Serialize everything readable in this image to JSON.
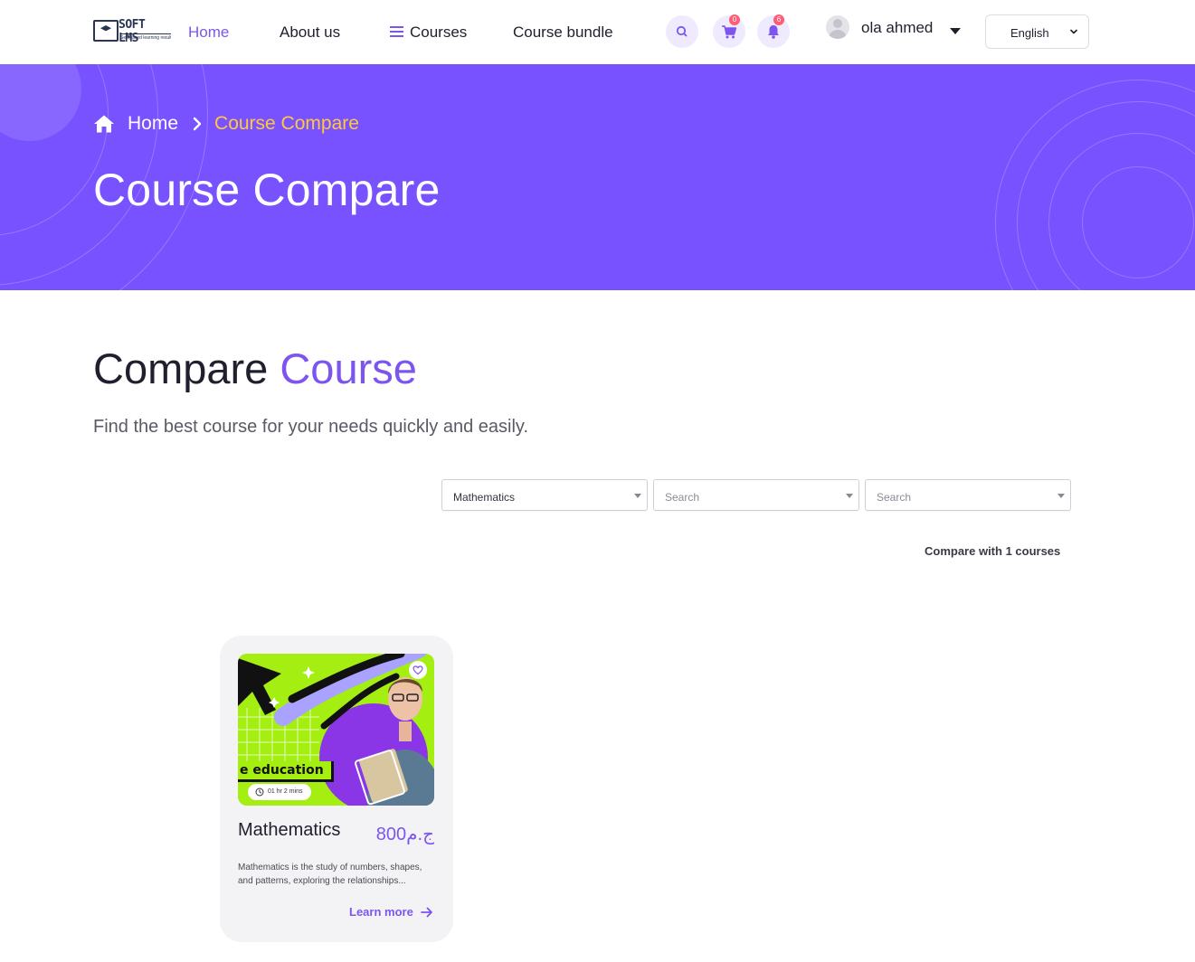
{
  "header": {
    "logo": {
      "brand": "SOFT LMS",
      "tagline": "Self-paced learning results"
    },
    "nav": {
      "home": "Home",
      "about": "About us",
      "courses": "Courses",
      "bundle": "Course bundle"
    },
    "cart_count": "0",
    "notification_count": "6",
    "user_name": "ola ahmed",
    "language": "English"
  },
  "hero": {
    "breadcrumb_home": "Home",
    "breadcrumb_current": "Course Compare",
    "title": "Course Compare"
  },
  "compare": {
    "title_main": "Compare ",
    "title_accent": "Course",
    "subtitle": "Find the best course for your needs quickly and easily.",
    "selects": [
      {
        "value": "Mathematics",
        "placeholder": false
      },
      {
        "value": "Search",
        "placeholder": true
      },
      {
        "value": "Search",
        "placeholder": true
      }
    ],
    "compare_count": "Compare with 1 courses"
  },
  "card": {
    "image_tag": "e education",
    "duration": "01 hr 2 mins",
    "name": "Mathematics",
    "price": "800ج.م",
    "description": "Mathematics is the study of numbers, shapes, and patterns, exploring the relationships...",
    "cta": "Learn more"
  },
  "colors": {
    "accent": "#7c55f0",
    "hero_bg": "#7752fe",
    "breadcrumb_current": "#ffc83d",
    "badge": "#ff5c77"
  },
  "icons": [
    "logo-icon",
    "menu-icon",
    "search-icon",
    "cart-icon",
    "bell-icon",
    "avatar",
    "chevron-down-icon",
    "home-icon",
    "chevron-right-icon",
    "heart-icon",
    "clock-icon",
    "arrow-right-icon"
  ]
}
